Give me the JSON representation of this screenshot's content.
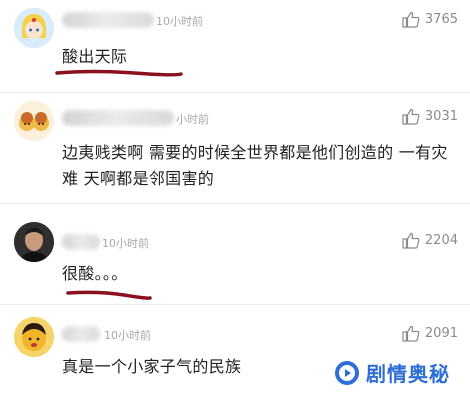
{
  "comments": [
    {
      "time": "10小时前",
      "likes": "3765",
      "text": "酸出天际"
    },
    {
      "time": "小时前",
      "likes": "3031",
      "text": "边夷贱类啊 需要的时候全世界都是他们创造的 一有灾难 天啊都是邻国害的"
    },
    {
      "time": "10小时前",
      "likes": "2204",
      "text": "很酸。。。"
    },
    {
      "time": "10小时前",
      "likes": "2091",
      "text": "真是一个小家子气的民族"
    }
  ],
  "watermark": {
    "text": "剧情奥秘",
    "color": "#2d6fd6"
  },
  "icons": {
    "like": "thumbs-up-icon",
    "watermark_logo": "play-logo-icon"
  },
  "accent": {
    "underline": "#8b1020"
  }
}
